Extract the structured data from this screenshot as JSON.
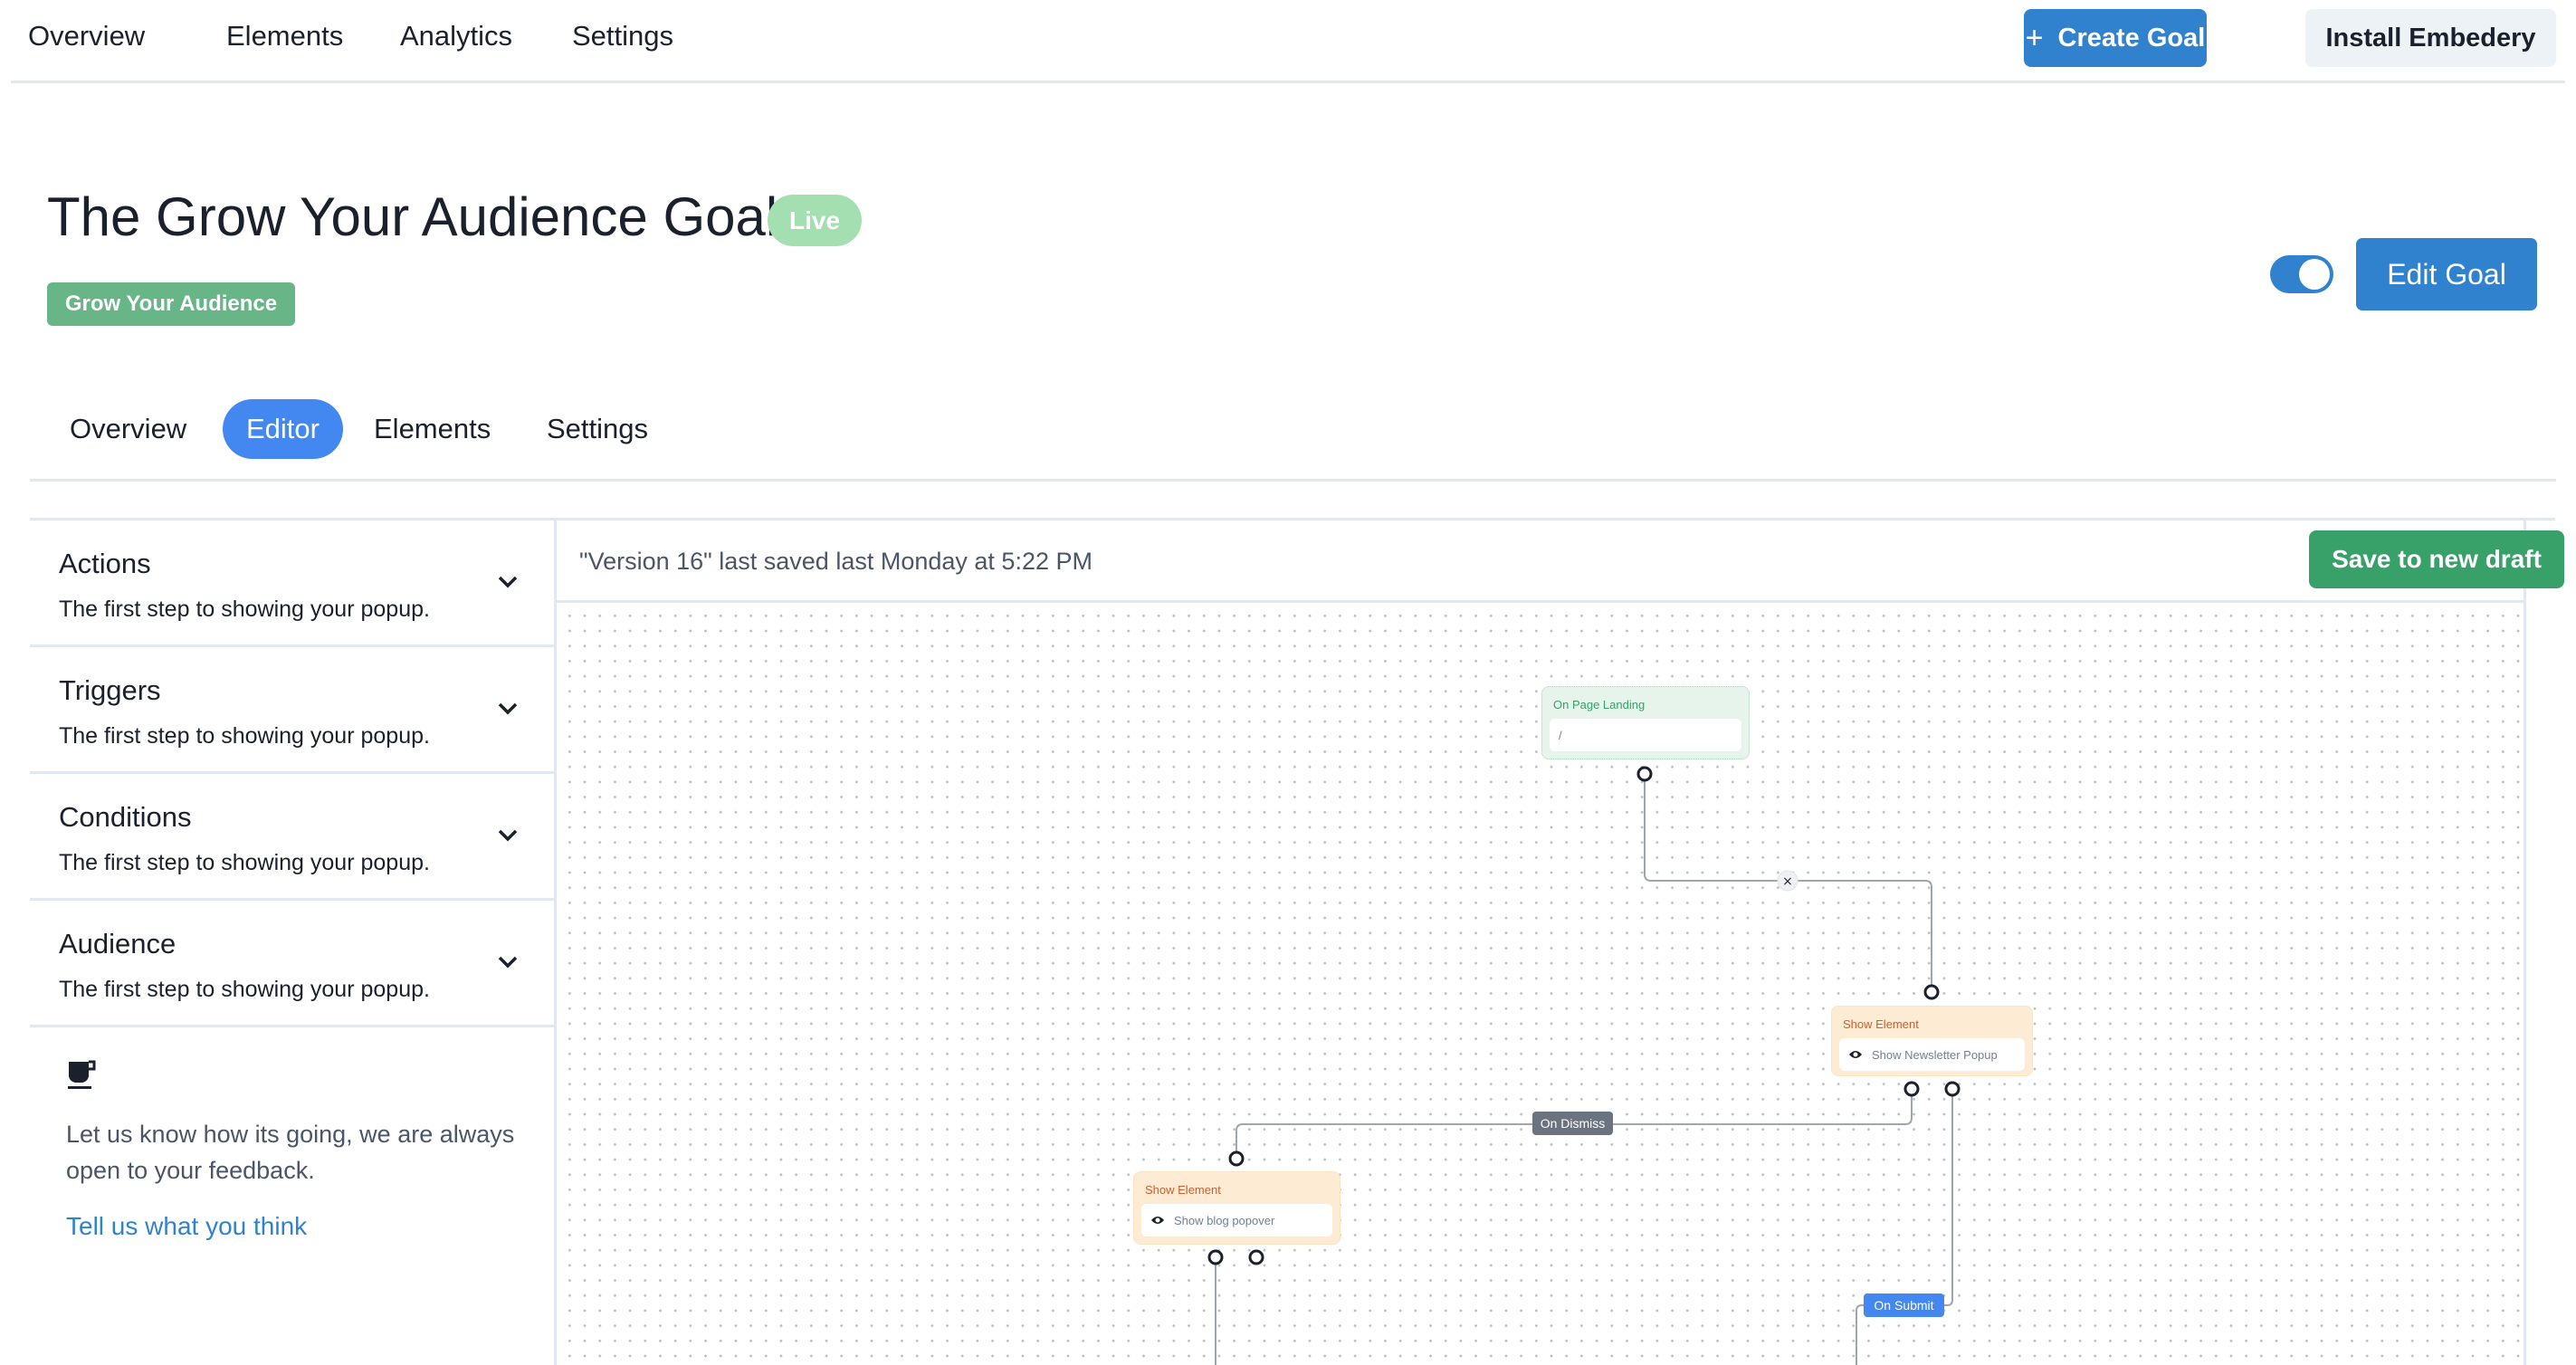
{
  "topnav": {
    "items": [
      "Overview",
      "Elements",
      "Analytics",
      "Settings"
    ],
    "create_goal": "Create Goal",
    "create_goal_icon": "plus-icon",
    "install": "Install Embedery"
  },
  "goal": {
    "title": "The Grow Your Audience Goal",
    "status": "Live",
    "tag": "Grow Your Audience",
    "enabled": true,
    "edit_label": "Edit Goal"
  },
  "subtabs": {
    "items": [
      "Overview",
      "Editor",
      "Elements",
      "Settings"
    ],
    "active": "Editor"
  },
  "sidebar": {
    "sections": [
      {
        "label": "Actions",
        "desc": "The first step to showing your popup."
      },
      {
        "label": "Triggers",
        "desc": "The first step to showing your popup."
      },
      {
        "label": "Conditions",
        "desc": "The first step to showing your popup."
      },
      {
        "label": "Audience",
        "desc": "The first step to showing your popup."
      }
    ],
    "feedback": {
      "icon": "coffee-cup-icon",
      "text": "Let us know how its going, we are always open to your feedback.",
      "link": "Tell us what you think"
    }
  },
  "editor": {
    "version_text": "\"Version 16\" last saved last Monday at 5:22 PM",
    "save_label": "Save to new draft",
    "nodes": [
      {
        "type": "trigger",
        "title": "On Page Landing",
        "value": "/"
      },
      {
        "type": "action",
        "title": "Show Element",
        "value": "Show Newsletter Popup",
        "icon": "eye-icon"
      },
      {
        "type": "action",
        "title": "Show Element",
        "value": "Show blog popover",
        "icon": "eye-icon"
      }
    ],
    "edge_labels": {
      "dismiss": "On Dismiss",
      "submit": "On Submit",
      "remove": "×"
    }
  },
  "colors": {
    "primary": "#3182ce",
    "success": "#38a169",
    "live_badge": "#a3dfb1",
    "tag": "#68b687",
    "active_tab": "#4388f0"
  }
}
